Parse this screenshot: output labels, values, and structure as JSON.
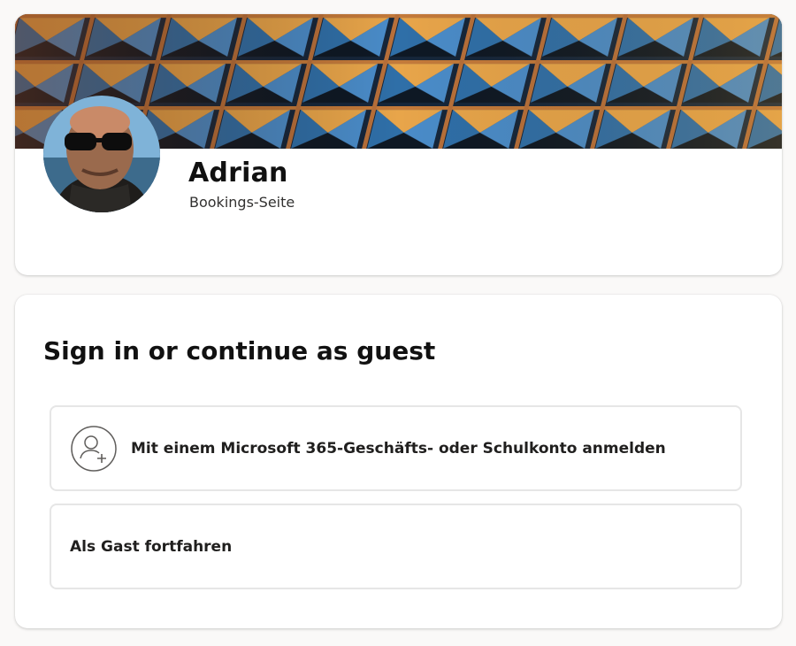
{
  "profile": {
    "name": "Adrian",
    "subtitle": "Bookings-Seite",
    "banner_image": "building-facade-photo",
    "avatar_image": "profile-photo-man-with-sunglasses"
  },
  "signin": {
    "title": "Sign in or continue as guest",
    "options": [
      {
        "icon": "person-add-icon",
        "label": "Mit einem Microsoft 365-Geschäfts- oder Schulkonto anmelden"
      },
      {
        "label": "Als Gast fortfahren"
      }
    ]
  },
  "colors": {
    "page_background": "#faf9f8",
    "card_background": "#ffffff",
    "option_border": "#e6e6e6",
    "text_primary": "#201f1e"
  }
}
